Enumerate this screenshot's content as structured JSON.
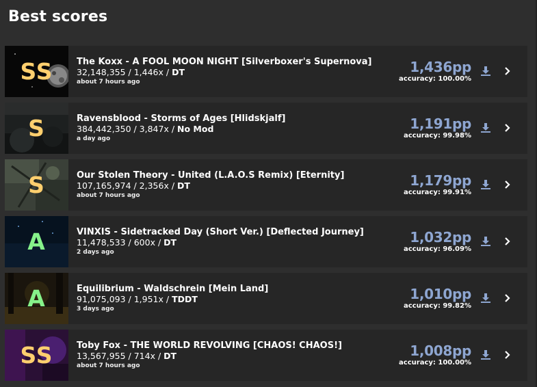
{
  "page": {
    "title": "Best scores"
  },
  "colors": {
    "pp": "#8ea6d1",
    "grade_ss": "#ffcf6e",
    "grade_s": "#ffcf6e",
    "grade_a": "#86f28a"
  },
  "scores": [
    {
      "grade": "SS",
      "song": "The Koxx - A FOOL MOON NIGHT [Silverboxer's Supernova]",
      "score": "32,148,355 / 1,446x / ",
      "mods": "DT",
      "time": "about 7 hours ago",
      "pp": "1,436pp",
      "acc_label": "accuracy: ",
      "acc": "100.00%"
    },
    {
      "grade": "S",
      "song": "Ravensblood - Storms of Ages [Hlidskjalf]",
      "score": "384,442,350 / 3,847x / ",
      "mods": "No Mod",
      "time": "a day ago",
      "pp": "1,191pp",
      "acc_label": "accuracy: ",
      "acc": "99.98%"
    },
    {
      "grade": "S",
      "song": "Our Stolen Theory - United (L.A.O.S Remix) [Eternity]",
      "score": "107,165,974 / 2,356x / ",
      "mods": "DT",
      "time": "about 7 hours ago",
      "pp": "1,179pp",
      "acc_label": "accuracy: ",
      "acc": "99.91%"
    },
    {
      "grade": "A",
      "song": "VINXIS - Sidetracked Day (Short Ver.) [Deflected Journey]",
      "score": "11,478,533 / 600x / ",
      "mods": "DT",
      "time": "2 days ago",
      "pp": "1,032pp",
      "acc_label": "accuracy: ",
      "acc": "96.09%"
    },
    {
      "grade": "A",
      "song": "Equilibrium - Waldschrein [Mein Land]",
      "score": "91,075,093 / 1,951x / ",
      "mods": "TDDT",
      "time": "3 days ago",
      "pp": "1,010pp",
      "acc_label": "accuracy: ",
      "acc": "99.82%"
    },
    {
      "grade": "SS",
      "song": "Toby Fox - THE WORLD REVOLVING [CHAOS! CHAOS!]",
      "score": "13,567,955 / 714x / ",
      "mods": "DT",
      "time": "about 7 hours ago",
      "pp": "1,008pp",
      "acc_label": "accuracy: ",
      "acc": "100.00%"
    }
  ]
}
